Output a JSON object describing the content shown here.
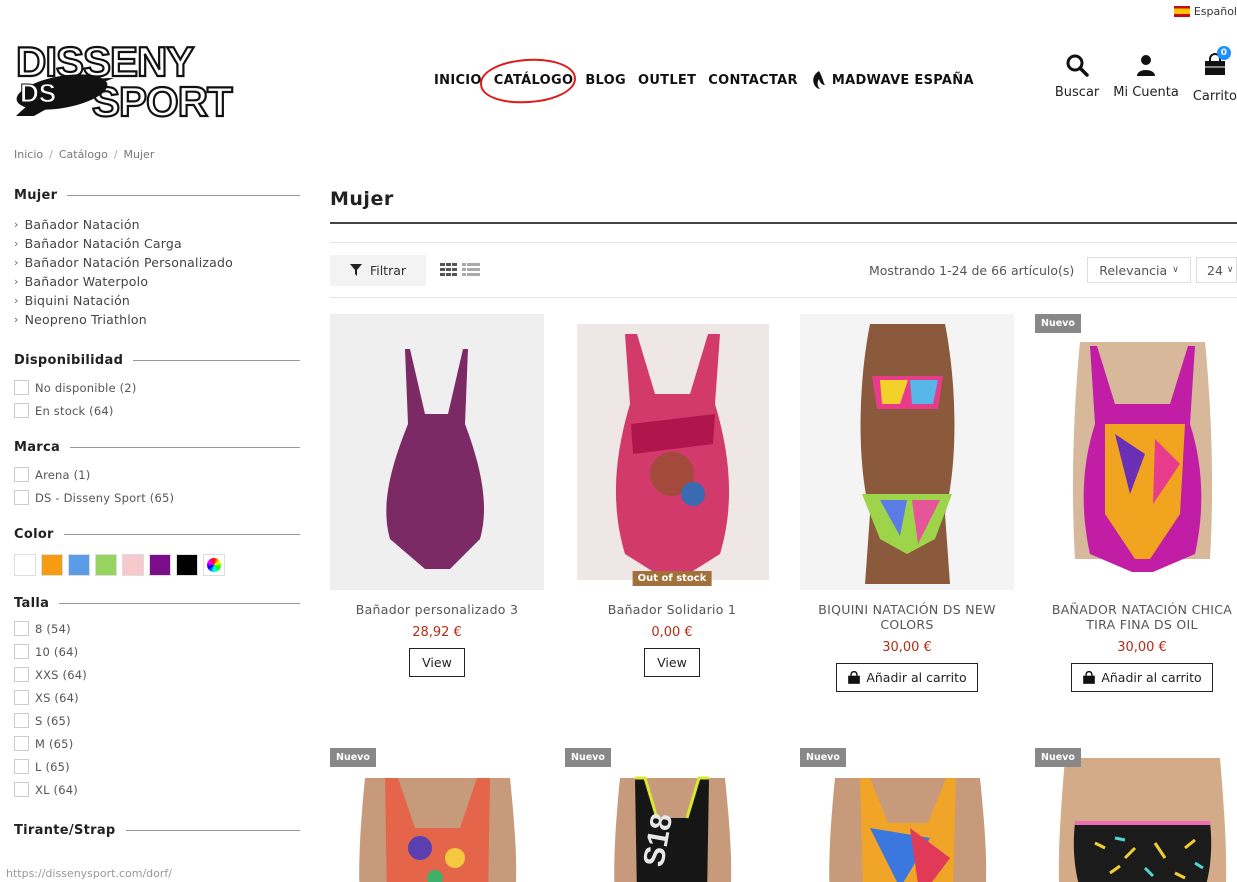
{
  "language": "Español",
  "logo": {
    "line1": "DISSENY",
    "line2": "SPORT",
    "mark": "DS"
  },
  "nav": {
    "items": [
      "INICIO",
      "CATÁLOGO",
      "BLOG",
      "OUTLET",
      "CONTACTAR"
    ],
    "madwave": "MADWAVE ESPAÑA"
  },
  "header_icons": {
    "search": "Buscar",
    "account": "Mi Cuenta",
    "cart": "Carrito",
    "cart_count": "0"
  },
  "breadcrumb": [
    "Inicio",
    "Catálogo",
    "Mujer"
  ],
  "sidebar": {
    "category_title": "Mujer",
    "categories": [
      "Bañador Natación",
      "Bañador Natación Carga",
      "Bañador Natación Personalizado",
      "Bañador Waterpolo",
      "Biquini Natación",
      "Neopreno Triathlon"
    ],
    "availability_title": "Disponibilidad",
    "availability": [
      "No disponible (2)",
      "En stock (64)"
    ],
    "brand_title": "Marca",
    "brands": [
      "Arena (1)",
      "DS - Disseny Sport (65)"
    ],
    "color_title": "Color",
    "colors": [
      "#ffffff",
      "#f59c12",
      "#5b9be8",
      "#96d35f",
      "#f7c8cc",
      "#7c0d8a",
      "#000000",
      "multicolor"
    ],
    "size_title": "Talla",
    "sizes": [
      "8 (54)",
      "10 (64)",
      "XXS (64)",
      "XS (64)",
      "S (65)",
      "M (65)",
      "L (65)",
      "XL (64)"
    ],
    "strap_title": "Tirante/Strap"
  },
  "content": {
    "title": "Mujer",
    "filter_label": "Filtrar",
    "count_text": "Mostrando 1-24 de 66 artículo(s)",
    "sort_label": "Relevancia",
    "per_page": "24"
  },
  "products": [
    {
      "name": "Bañador personalizado 3",
      "price": "28,92 €",
      "action": "View",
      "badge": ""
    },
    {
      "name": "Bañador Solidario 1",
      "price": "0,00 €",
      "action": "View",
      "badge": "Out of stock"
    },
    {
      "name": "BIQUINI NATACIÓN DS NEW COLORS",
      "price": "30,00 €",
      "action": "Añadir al carrito",
      "badge": ""
    },
    {
      "name": "BAÑADOR NATACIÓN CHICA TIRA FINA DS OIL",
      "price": "30,00 €",
      "action": "Añadir al carrito",
      "badge": "Nuevo"
    }
  ],
  "row2_badges": [
    "Nuevo",
    "Nuevo",
    "Nuevo",
    "Nuevo"
  ],
  "status_url": "https://dissenysport.com/dorf/"
}
